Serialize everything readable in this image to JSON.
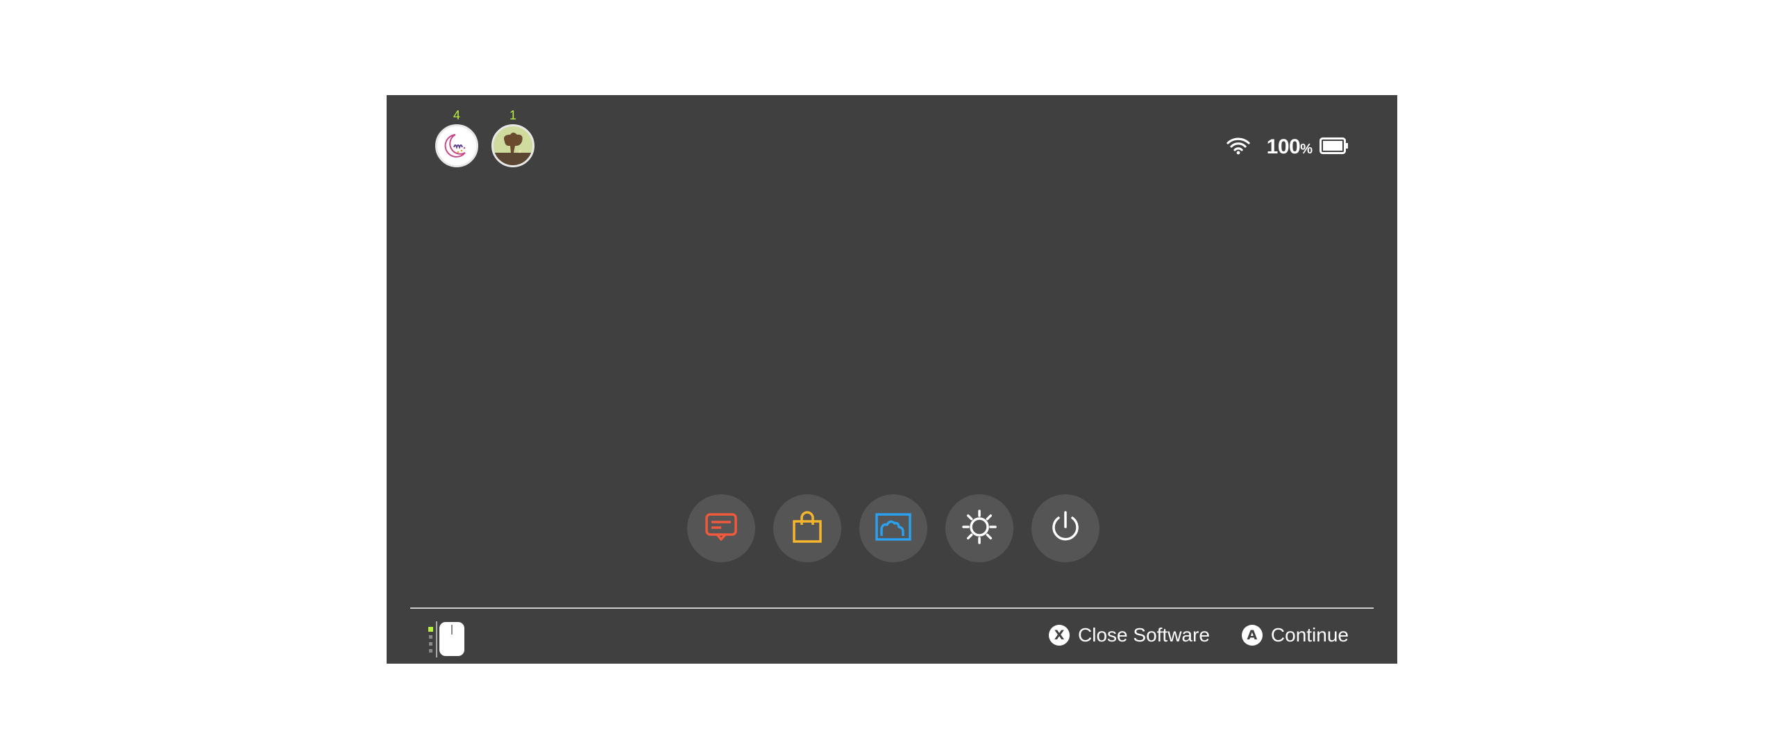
{
  "users": [
    {
      "badge": "4",
      "avatar_icon": "moon-avatar-icon"
    },
    {
      "badge": "1",
      "avatar_icon": "tree-avatar-icon"
    }
  ],
  "status": {
    "wifi_icon": "wifi-icon",
    "battery_percent": "100",
    "percent_sign": "%",
    "battery_icon": "battery-icon",
    "battery_level": 1.0
  },
  "dock": [
    {
      "name": "news",
      "icon": "news-icon",
      "color": "#f05a3c"
    },
    {
      "name": "shop",
      "icon": "shop-bag-icon",
      "color": "#f5b52d"
    },
    {
      "name": "album",
      "icon": "album-icon",
      "color": "#2aa0f0"
    },
    {
      "name": "settings",
      "icon": "gear-icon",
      "color": "#ffffff"
    },
    {
      "name": "power",
      "icon": "power-icon",
      "color": "#ffffff"
    }
  ],
  "footer": {
    "close": {
      "glyph": "X",
      "label": "Close Software"
    },
    "continue": {
      "glyph": "A",
      "label": "Continue"
    }
  },
  "colors": {
    "screen_bg": "#404040",
    "badge": "#b6f040",
    "dock_button": "#555555"
  }
}
